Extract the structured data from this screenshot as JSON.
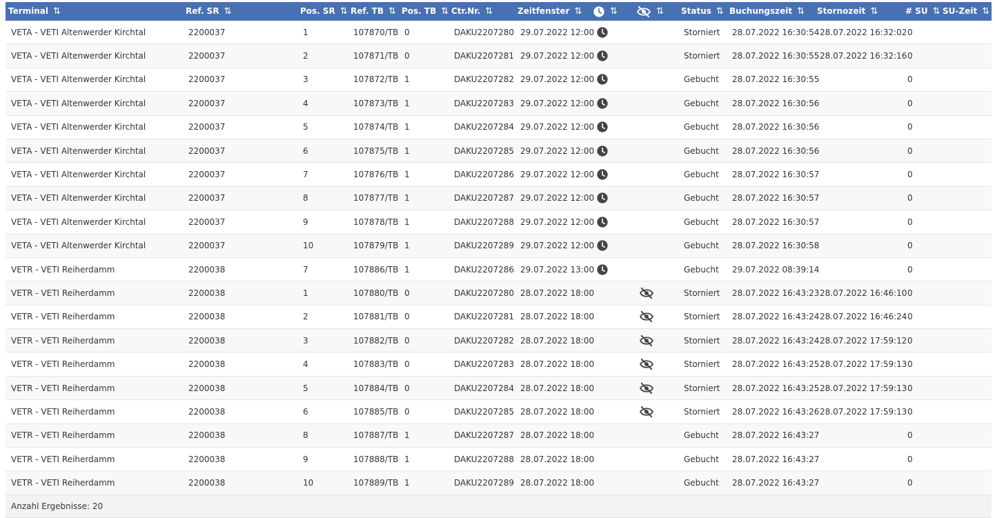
{
  "columns": [
    {
      "key": "terminal",
      "label": "Terminal",
      "sortable": true
    },
    {
      "key": "ref_sr",
      "label": "Ref. SR",
      "sortable": true
    },
    {
      "key": "pos_sr",
      "label": "Pos. SR",
      "sortable": true
    },
    {
      "key": "ref_tb",
      "label": "Ref. TB",
      "sortable": true
    },
    {
      "key": "pos_tb",
      "label": "Pos. TB",
      "sortable": true
    },
    {
      "key": "ctr_nr",
      "label": "Ctr.Nr.",
      "sortable": true
    },
    {
      "key": "zeitfenster",
      "label": "Zeitfenster",
      "sortable": true
    },
    {
      "key": "clock",
      "label": "",
      "icon": "clock-icon",
      "sortable": true
    },
    {
      "key": "hidden",
      "label": "",
      "icon": "eye-slash-icon",
      "sortable": true
    },
    {
      "key": "status",
      "label": "Status",
      "sortable": true
    },
    {
      "key": "buchungszeit",
      "label": "Buchungszeit",
      "sortable": true
    },
    {
      "key": "stornozeit",
      "label": "Stornozeit",
      "sortable": true
    },
    {
      "key": "su_count",
      "label": "# SU",
      "sortable": true
    },
    {
      "key": "su_zeit",
      "label": "SU-Zeit",
      "sortable": true
    }
  ],
  "sort_icon": "⇅",
  "rows": [
    {
      "terminal": "VETA - VETI Altenwerder Kirchtal",
      "ref_sr": "2200037",
      "pos_sr": "1",
      "ref_tb": "107870/TB",
      "pos_tb": "0",
      "ctr_nr": "DAKU2207280",
      "zeitfenster": "29.07.2022 12:00",
      "clock": true,
      "hidden": false,
      "status": "Storniert",
      "buchungszeit": "28.07.2022 16:30:54",
      "stornozeit": "28.07.2022 16:32:02",
      "su_count": "0",
      "su_zeit": ""
    },
    {
      "terminal": "VETA - VETI Altenwerder Kirchtal",
      "ref_sr": "2200037",
      "pos_sr": "2",
      "ref_tb": "107871/TB",
      "pos_tb": "0",
      "ctr_nr": "DAKU2207281",
      "zeitfenster": "29.07.2022 12:00",
      "clock": true,
      "hidden": false,
      "status": "Storniert",
      "buchungszeit": "28.07.2022 16:30:55",
      "stornozeit": "28.07.2022 16:32:16",
      "su_count": "0",
      "su_zeit": ""
    },
    {
      "terminal": "VETA - VETI Altenwerder Kirchtal",
      "ref_sr": "2200037",
      "pos_sr": "3",
      "ref_tb": "107872/TB",
      "pos_tb": "1",
      "ctr_nr": "DAKU2207282",
      "zeitfenster": "29.07.2022 12:00",
      "clock": true,
      "hidden": false,
      "status": "Gebucht",
      "buchungszeit": "28.07.2022 16:30:55",
      "stornozeit": "",
      "su_count": "0",
      "su_zeit": ""
    },
    {
      "terminal": "VETA - VETI Altenwerder Kirchtal",
      "ref_sr": "2200037",
      "pos_sr": "4",
      "ref_tb": "107873/TB",
      "pos_tb": "1",
      "ctr_nr": "DAKU2207283",
      "zeitfenster": "29.07.2022 12:00",
      "clock": true,
      "hidden": false,
      "status": "Gebucht",
      "buchungszeit": "28.07.2022 16:30:56",
      "stornozeit": "",
      "su_count": "0",
      "su_zeit": ""
    },
    {
      "terminal": "VETA - VETI Altenwerder Kirchtal",
      "ref_sr": "2200037",
      "pos_sr": "5",
      "ref_tb": "107874/TB",
      "pos_tb": "1",
      "ctr_nr": "DAKU2207284",
      "zeitfenster": "29.07.2022 12:00",
      "clock": true,
      "hidden": false,
      "status": "Gebucht",
      "buchungszeit": "28.07.2022 16:30:56",
      "stornozeit": "",
      "su_count": "0",
      "su_zeit": ""
    },
    {
      "terminal": "VETA - VETI Altenwerder Kirchtal",
      "ref_sr": "2200037",
      "pos_sr": "6",
      "ref_tb": "107875/TB",
      "pos_tb": "1",
      "ctr_nr": "DAKU2207285",
      "zeitfenster": "29.07.2022 12:00",
      "clock": true,
      "hidden": false,
      "status": "Gebucht",
      "buchungszeit": "28.07.2022 16:30:56",
      "stornozeit": "",
      "su_count": "0",
      "su_zeit": ""
    },
    {
      "terminal": "VETA - VETI Altenwerder Kirchtal",
      "ref_sr": "2200037",
      "pos_sr": "7",
      "ref_tb": "107876/TB",
      "pos_tb": "1",
      "ctr_nr": "DAKU2207286",
      "zeitfenster": "29.07.2022 12:00",
      "clock": true,
      "hidden": false,
      "status": "Gebucht",
      "buchungszeit": "28.07.2022 16:30:57",
      "stornozeit": "",
      "su_count": "0",
      "su_zeit": ""
    },
    {
      "terminal": "VETA - VETI Altenwerder Kirchtal",
      "ref_sr": "2200037",
      "pos_sr": "8",
      "ref_tb": "107877/TB",
      "pos_tb": "1",
      "ctr_nr": "DAKU2207287",
      "zeitfenster": "29.07.2022 12:00",
      "clock": true,
      "hidden": false,
      "status": "Gebucht",
      "buchungszeit": "28.07.2022 16:30:57",
      "stornozeit": "",
      "su_count": "0",
      "su_zeit": ""
    },
    {
      "terminal": "VETA - VETI Altenwerder Kirchtal",
      "ref_sr": "2200037",
      "pos_sr": "9",
      "ref_tb": "107878/TB",
      "pos_tb": "1",
      "ctr_nr": "DAKU2207288",
      "zeitfenster": "29.07.2022 12:00",
      "clock": true,
      "hidden": false,
      "status": "Gebucht",
      "buchungszeit": "28.07.2022 16:30:57",
      "stornozeit": "",
      "su_count": "0",
      "su_zeit": ""
    },
    {
      "terminal": "VETA - VETI Altenwerder Kirchtal",
      "ref_sr": "2200037",
      "pos_sr": "10",
      "ref_tb": "107879/TB",
      "pos_tb": "1",
      "ctr_nr": "DAKU2207289",
      "zeitfenster": "29.07.2022 12:00",
      "clock": true,
      "hidden": false,
      "status": "Gebucht",
      "buchungszeit": "28.07.2022 16:30:58",
      "stornozeit": "",
      "su_count": "0",
      "su_zeit": ""
    },
    {
      "terminal": "VETR - VETI Reiherdamm",
      "ref_sr": "2200038",
      "pos_sr": "7",
      "ref_tb": "107886/TB",
      "pos_tb": "1",
      "ctr_nr": "DAKU2207286",
      "zeitfenster": "29.07.2022 13:00",
      "clock": true,
      "hidden": false,
      "status": "Gebucht",
      "buchungszeit": "29.07.2022 08:39:14",
      "stornozeit": "",
      "su_count": "0",
      "su_zeit": ""
    },
    {
      "terminal": "VETR - VETI Reiherdamm",
      "ref_sr": "2200038",
      "pos_sr": "1",
      "ref_tb": "107880/TB",
      "pos_tb": "0",
      "ctr_nr": "DAKU2207280",
      "zeitfenster": "28.07.2022 18:00",
      "clock": false,
      "hidden": true,
      "status": "Storniert",
      "buchungszeit": "28.07.2022 16:43:23",
      "stornozeit": "28.07.2022 16:46:10",
      "su_count": "0",
      "su_zeit": ""
    },
    {
      "terminal": "VETR - VETI Reiherdamm",
      "ref_sr": "2200038",
      "pos_sr": "2",
      "ref_tb": "107881/TB",
      "pos_tb": "0",
      "ctr_nr": "DAKU2207281",
      "zeitfenster": "28.07.2022 18:00",
      "clock": false,
      "hidden": true,
      "status": "Storniert",
      "buchungszeit": "28.07.2022 16:43:24",
      "stornozeit": "28.07.2022 16:46:24",
      "su_count": "0",
      "su_zeit": ""
    },
    {
      "terminal": "VETR - VETI Reiherdamm",
      "ref_sr": "2200038",
      "pos_sr": "3",
      "ref_tb": "107882/TB",
      "pos_tb": "0",
      "ctr_nr": "DAKU2207282",
      "zeitfenster": "28.07.2022 18:00",
      "clock": false,
      "hidden": true,
      "status": "Storniert",
      "buchungszeit": "28.07.2022 16:43:24",
      "stornozeit": "28.07.2022 17:59:12",
      "su_count": "0",
      "su_zeit": ""
    },
    {
      "terminal": "VETR - VETI Reiherdamm",
      "ref_sr": "2200038",
      "pos_sr": "4",
      "ref_tb": "107883/TB",
      "pos_tb": "0",
      "ctr_nr": "DAKU2207283",
      "zeitfenster": "28.07.2022 18:00",
      "clock": false,
      "hidden": true,
      "status": "Storniert",
      "buchungszeit": "28.07.2022 16:43:25",
      "stornozeit": "28.07.2022 17:59:13",
      "su_count": "0",
      "su_zeit": ""
    },
    {
      "terminal": "VETR - VETI Reiherdamm",
      "ref_sr": "2200038",
      "pos_sr": "5",
      "ref_tb": "107884/TB",
      "pos_tb": "0",
      "ctr_nr": "DAKU2207284",
      "zeitfenster": "28.07.2022 18:00",
      "clock": false,
      "hidden": true,
      "status": "Storniert",
      "buchungszeit": "28.07.2022 16:43:25",
      "stornozeit": "28.07.2022 17:59:13",
      "su_count": "0",
      "su_zeit": ""
    },
    {
      "terminal": "VETR - VETI Reiherdamm",
      "ref_sr": "2200038",
      "pos_sr": "6",
      "ref_tb": "107885/TB",
      "pos_tb": "0",
      "ctr_nr": "DAKU2207285",
      "zeitfenster": "28.07.2022 18:00",
      "clock": false,
      "hidden": true,
      "status": "Storniert",
      "buchungszeit": "28.07.2022 16:43:26",
      "stornozeit": "28.07.2022 17:59:13",
      "su_count": "0",
      "su_zeit": ""
    },
    {
      "terminal": "VETR - VETI Reiherdamm",
      "ref_sr": "2200038",
      "pos_sr": "8",
      "ref_tb": "107887/TB",
      "pos_tb": "1",
      "ctr_nr": "DAKU2207287",
      "zeitfenster": "28.07.2022 18:00",
      "clock": false,
      "hidden": false,
      "status": "Gebucht",
      "buchungszeit": "28.07.2022 16:43:27",
      "stornozeit": "",
      "su_count": "0",
      "su_zeit": ""
    },
    {
      "terminal": "VETR - VETI Reiherdamm",
      "ref_sr": "2200038",
      "pos_sr": "9",
      "ref_tb": "107888/TB",
      "pos_tb": "1",
      "ctr_nr": "DAKU2207288",
      "zeitfenster": "28.07.2022 18:00",
      "clock": false,
      "hidden": false,
      "status": "Gebucht",
      "buchungszeit": "28.07.2022 16:43:27",
      "stornozeit": "",
      "su_count": "0",
      "su_zeit": ""
    },
    {
      "terminal": "VETR - VETI Reiherdamm",
      "ref_sr": "2200038",
      "pos_sr": "10",
      "ref_tb": "107889/TB",
      "pos_tb": "1",
      "ctr_nr": "DAKU2207289",
      "zeitfenster": "28.07.2022 18:00",
      "clock": false,
      "hidden": false,
      "status": "Gebucht",
      "buchungszeit": "28.07.2022 16:43:27",
      "stornozeit": "",
      "su_count": "0",
      "su_zeit": ""
    }
  ],
  "footer": {
    "results_label": "Anzahl Ergebnisse: 20"
  },
  "colors": {
    "header_bg": "#4770b5",
    "header_text": "#ffffff",
    "icon_dark": "#444444"
  }
}
